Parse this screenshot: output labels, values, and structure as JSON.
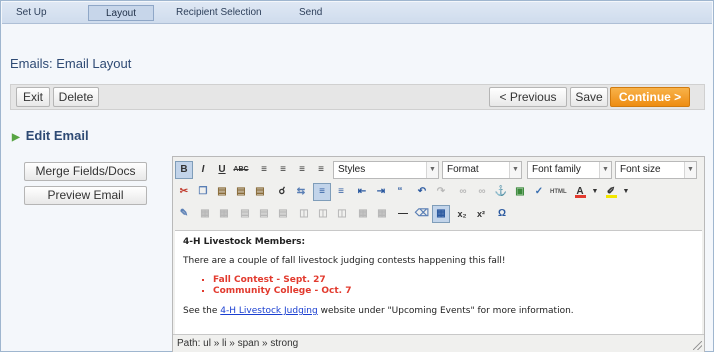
{
  "nav": {
    "tabs": [
      {
        "label": "Set Up"
      },
      {
        "label": "Layout"
      },
      {
        "label": "Recipient Selection"
      },
      {
        "label": "Send"
      }
    ]
  },
  "page_title": "Emails: Email Layout",
  "actions": {
    "exit": "Exit",
    "delete": "Delete",
    "previous": "< Previous",
    "save": "Save",
    "continue": "Continue >"
  },
  "section_title": "Edit Email",
  "side": {
    "merge": "Merge Fields/Docs",
    "preview": "Preview Email"
  },
  "editor": {
    "selects": {
      "styles": "Styles",
      "format": "Format",
      "font_family": "Font family",
      "font_size": "Font size"
    },
    "content": {
      "heading": "4-H Livestock Members:",
      "intro": "There are a couple of fall livestock judging contests happening this fall!",
      "items": [
        "Fall Contest - Sept. 27",
        "Community College - Oct. 7"
      ],
      "outro_before": "See the ",
      "outro_link": "4-H Livestock Judging",
      "outro_after": " website under \"Upcoming Events\" for more information."
    },
    "path": "Path: ul » li » span » strong"
  },
  "colors": {
    "accent": "#ee8d12",
    "title": "#2e4a74",
    "highlight": "#e23a2e",
    "link": "#1a3fd1"
  }
}
